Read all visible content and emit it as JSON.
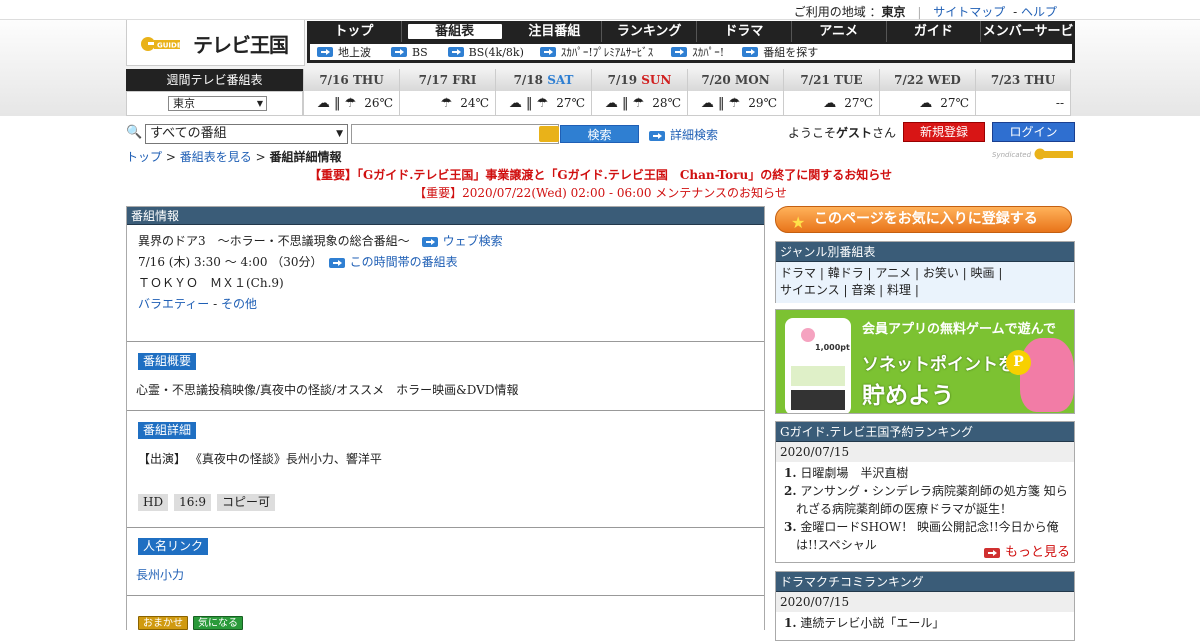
{
  "topbar": {
    "region_label": "ご利用の地域 ：",
    "region": "東京",
    "sitemap": "サイトマップ",
    "sep": "-",
    "help": "ヘルプ"
  },
  "logo": {
    "text": "テレビ王国"
  },
  "nav": {
    "tabs": [
      "トップ",
      "番組表",
      "注目番組",
      "ランキング",
      "ドラマ",
      "アニメ",
      "ガイド",
      "メンバーサービス"
    ],
    "active": "番組表",
    "sub": [
      "地上波",
      "BS",
      "BS(4k/8k)",
      "ｽｶﾊﾟｰ!ﾌﾟﾚﾐｱﾑｻｰﾋﾞｽ",
      "ｽｶﾊﾟｰ!",
      "番組を探す"
    ]
  },
  "week": {
    "label": "週間テレビ番組表",
    "area": "東京",
    "days": [
      {
        "date": "7/16",
        "dow": "THU",
        "type": "",
        "icons": "☁ ‖ ☂",
        "temp": "26℃"
      },
      {
        "date": "7/17",
        "dow": "FRI",
        "type": "",
        "icons": "☂",
        "temp": "24℃"
      },
      {
        "date": "7/18",
        "dow": "SAT",
        "type": "sat",
        "icons": "☁ ‖ ☂",
        "temp": "27℃"
      },
      {
        "date": "7/19",
        "dow": "SUN",
        "type": "sun",
        "icons": "☁ ‖ ☂",
        "temp": "28℃"
      },
      {
        "date": "7/20",
        "dow": "MON",
        "type": "",
        "icons": "☁ ‖ ☂",
        "temp": "29℃"
      },
      {
        "date": "7/21",
        "dow": "TUE",
        "type": "",
        "icons": "☁",
        "temp": "27℃"
      },
      {
        "date": "7/22",
        "dow": "WED",
        "type": "",
        "icons": "☁",
        "temp": "27℃"
      },
      {
        "date": "7/23",
        "dow": "THU",
        "type": "",
        "icons": "",
        "temp": "--"
      }
    ]
  },
  "search": {
    "category": "すべての番組",
    "button": "検索",
    "advanced": "詳細検索",
    "welcome": "ようこそ",
    "guest": "ゲスト",
    "san": "さん",
    "register": "新規登録",
    "login": "ログイン"
  },
  "breadcrumb": {
    "top": "トップ",
    "sep": ">",
    "epg": "番組表を見る",
    "current": "番組詳細情報"
  },
  "syndicated": "Syndicated",
  "notices": {
    "n1": "【重要】「Gガイド.テレビ王国」事業譲渡と「Gガイド.テレビ王国　Chan-Toru」の終了に関するお知らせ",
    "n2": "【重要】2020/07/22(Wed) 02:00 - 06:00 メンテナンスのお知らせ"
  },
  "program": {
    "header": "番組情報",
    "title": "異界のドア3　～ホラー・不思議現象の総合番組～",
    "web_search": "ウェブ検索",
    "time": "7/16 (木) 3:30 ～ 4:00 （30分）",
    "same_time": "この時間帯の番組表",
    "channel": "ＴＯＫＹＯ　ＭＸ１(Ch.9)",
    "genre1": "バラエティー",
    "genre_sep": "-",
    "genre2": "その他",
    "summary_tag": "番組概要",
    "summary": "心霊・不思議投稿映像/真夜中の怪談/オススメ　ホラー映画&DVD情報",
    "detail_tag": "番組詳細",
    "detail": "【出演】 《真夜中の怪談》長州小力、響洋平",
    "badges": [
      "HD",
      "16:9",
      "コピー可"
    ],
    "person_tag": "人名リンク",
    "person": "長州小力",
    "btn_omakase": "おまかせ",
    "btn_kininaru": "気になる"
  },
  "side": {
    "fav": "このページをお気に入りに登録する",
    "genre_header": "ジャンル別番組表",
    "genres_line1": [
      "ドラマ",
      "韓ドラ",
      "アニメ",
      "お笑い",
      "映画"
    ],
    "genres_line2": [
      "サイエンス",
      "音楽",
      "料理"
    ],
    "banner": {
      "t1": "会員アプリの無料ゲームで遊んで",
      "t2": "ソネットポイントを",
      "t3": "貯めよう",
      "phone": "1,000pt",
      "p": "P"
    },
    "rank1": {
      "header": "Gガイド.テレビ王国予約ランキング",
      "date": "2020/07/15",
      "items": [
        "日曜劇場　半沢直樹",
        "アンサング・シンデレラ病院薬剤師の処方箋 知られざる病院薬剤師の医療ドラマが誕生！",
        "金曜ロードSHOW！ 映画公開記念!!今日から俺は!!スペシャル"
      ],
      "more": "もっと見る"
    },
    "rank2": {
      "header": "ドラマクチコミランキング",
      "date": "2020/07/15",
      "items": [
        "連続テレビ小説「エール」"
      ]
    }
  },
  "colors": {
    "accent": "#2f7fd2",
    "notice": "#d01010",
    "header_bg": "#3a5c78"
  }
}
